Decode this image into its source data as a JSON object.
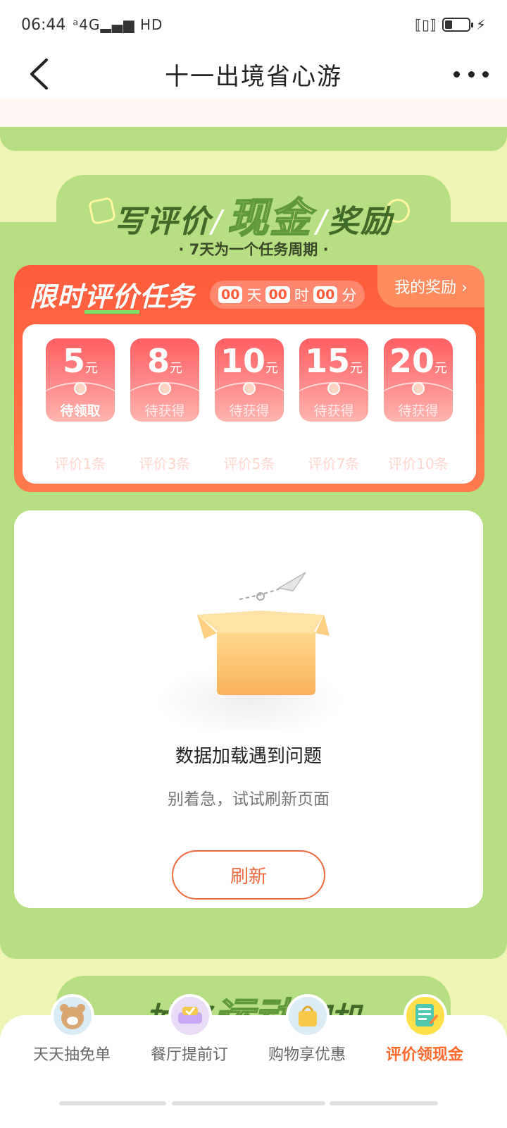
{
  "status_bar": {
    "time": "06:44",
    "network": "4G",
    "hd": "HD"
  },
  "nav": {
    "title": "十一出境省心游"
  },
  "header": {
    "part1": "写评价",
    "big": "现金",
    "part2": "奖励",
    "subtitle": "· 7天为一个任务周期 ·"
  },
  "task": {
    "title_prefix": "限时",
    "title_highlight": "评价",
    "title_suffix": "任务",
    "timer": {
      "days": "00",
      "day_unit": "天",
      "hours": "00",
      "hour_unit": "时",
      "minutes": "00",
      "minute_unit": "分"
    },
    "my_reward_label": "我的奖励 ›",
    "rewards": [
      {
        "amount": "5",
        "unit": "元",
        "status": "待领取",
        "condition": "评价1条"
      },
      {
        "amount": "8",
        "unit": "元",
        "status": "待获得",
        "condition": "评价3条"
      },
      {
        "amount": "10",
        "unit": "元",
        "status": "待获得",
        "condition": "评价5条"
      },
      {
        "amount": "15",
        "unit": "元",
        "status": "待获得",
        "condition": "评价7条"
      },
      {
        "amount": "20",
        "unit": "元",
        "status": "待获得",
        "condition": "评价10条"
      }
    ]
  },
  "empty_state": {
    "title": "数据加载遇到问题",
    "subtitle": "别着急，试试刷新页面",
    "button": "刷新"
  },
  "next_section": {
    "part1": "抽奖",
    "big": "运动",
    "part2": "相机"
  },
  "tabs": [
    {
      "label": "天天抽免单",
      "icon": "bear-icon",
      "color": "#d9ecf6"
    },
    {
      "label": "餐厅提前订",
      "icon": "sofa-icon",
      "color": "#e8dcf7"
    },
    {
      "label": "购物享优惠",
      "icon": "shopping-bag-icon",
      "color": "#dcecf7"
    },
    {
      "label": "评价领现金",
      "icon": "notepad-icon",
      "color": "#ffe04a",
      "active": true
    }
  ],
  "colors": {
    "accent": "#ff6a2c",
    "green": "#b6de82",
    "red": "#ff5b3c"
  }
}
